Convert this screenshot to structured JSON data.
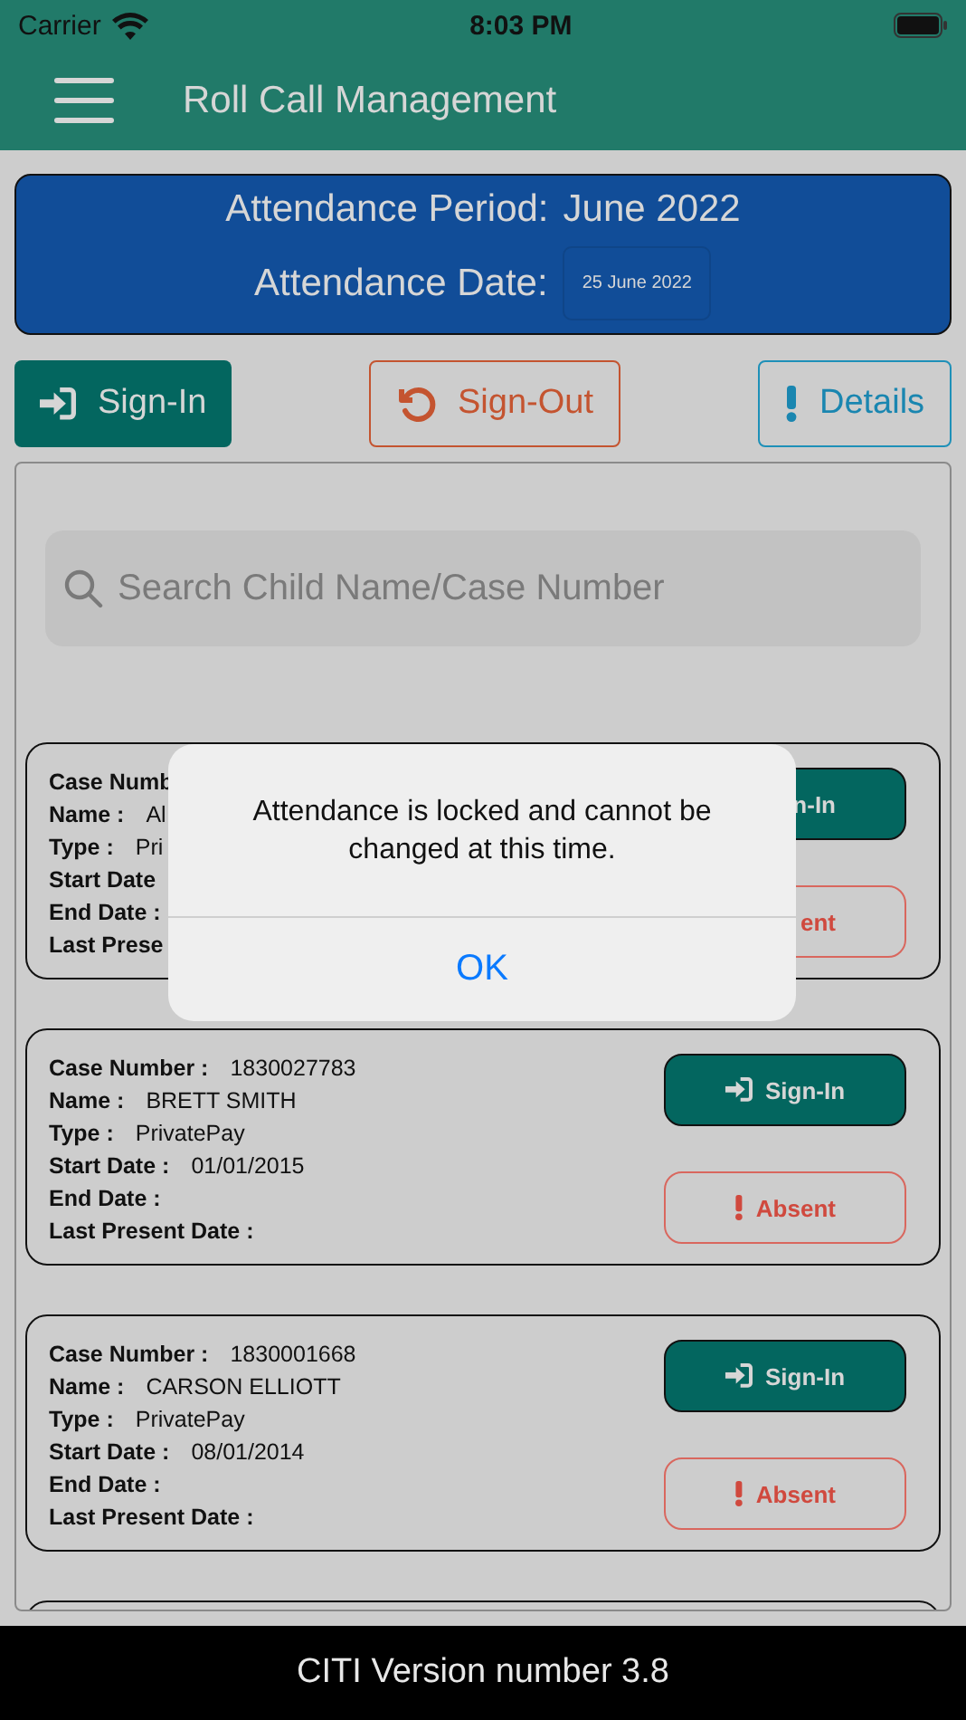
{
  "status_bar": {
    "carrier": "Carrier",
    "time": "8:03 PM"
  },
  "nav": {
    "title": "Roll Call Management"
  },
  "period": {
    "label": "Attendance Period:",
    "value": "June 2022",
    "date_label": "Attendance Date:",
    "date_value": "25 June 2022"
  },
  "actions": [
    {
      "kind": "signin",
      "label": "Sign-In"
    },
    {
      "kind": "signout",
      "label": "Sign-Out"
    },
    {
      "kind": "details",
      "label": "Details"
    }
  ],
  "search": {
    "placeholder": "Search Child Name/Case Number"
  },
  "records": [
    {
      "covered": true,
      "fields": [
        {
          "label": "Case Numb"
        },
        {
          "label": "Name :",
          "value": "Al"
        },
        {
          "label": "Type :",
          "value": "Pri"
        },
        {
          "label": "Start Date"
        },
        {
          "label": "End Date :"
        },
        {
          "label": "Last Prese"
        }
      ],
      "sign_in": "n-In",
      "absent": "ent"
    },
    {
      "covered": false,
      "fields": [
        {
          "label": "Case Number :",
          "value": "1830027783"
        },
        {
          "label": "Name :",
          "value": "BRETT SMITH"
        },
        {
          "label": "Type :",
          "value": "PrivatePay"
        },
        {
          "label": "Start Date :",
          "value": "01/01/2015"
        },
        {
          "label": "End Date :"
        },
        {
          "label": "Last Present Date :"
        }
      ],
      "sign_in": "Sign-In",
      "absent": "Absent"
    },
    {
      "covered": false,
      "fields": [
        {
          "label": "Case Number :",
          "value": "1830001668"
        },
        {
          "label": "Name :",
          "value": "CARSON ELLIOTT"
        },
        {
          "label": "Type :",
          "value": "PrivatePay"
        },
        {
          "label": "Start Date :",
          "value": "08/01/2014"
        },
        {
          "label": "End Date :"
        },
        {
          "label": "Last Present Date :"
        }
      ],
      "sign_in": "Sign-In",
      "absent": "Absent"
    }
  ],
  "alert": {
    "message": "Attendance is locked and cannot be changed at this time.",
    "button": "OK"
  },
  "footer": {
    "text": "CITI Version number 3.8"
  }
}
